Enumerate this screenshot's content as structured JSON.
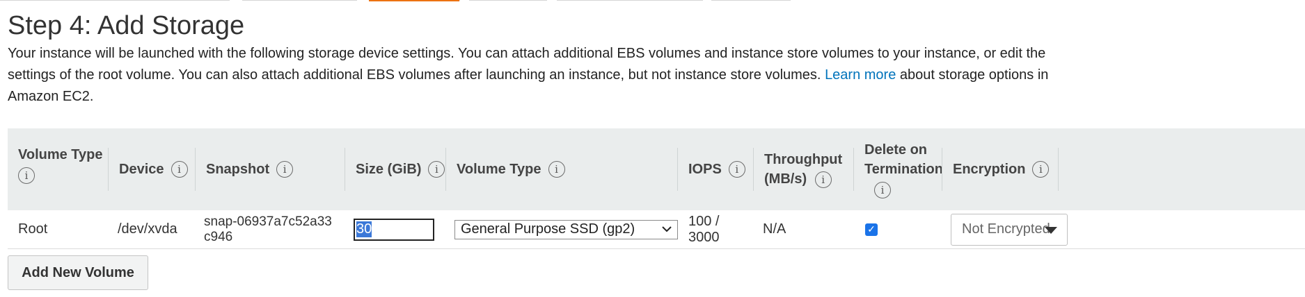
{
  "page": {
    "title": "Step 4: Add Storage",
    "description": "Your instance will be launched with the following storage device settings. You can attach additional EBS volumes and instance store volumes to your instance, or edit the settings of the root volume. You can also attach additional EBS volumes after launching an instance, but not instance store volumes.",
    "learn_more": "Learn more",
    "description_tail": "about storage options in Amazon EC2."
  },
  "table": {
    "headers": {
      "volume_type": "Volume Type",
      "device": "Device",
      "snapshot": "Snapshot",
      "size": "Size (GiB)",
      "volume_type2": "Volume Type",
      "iops": "IOPS",
      "throughput": "Throughput (MB/s)",
      "delete_on_termination": "Delete on Termination",
      "encryption": "Encryption"
    },
    "rows": [
      {
        "volume_type": "Root",
        "device": "/dev/xvda",
        "snapshot": "snap-06937a7c52a33c946",
        "size": "30",
        "volume_type_select": "General Purpose SSD (gp2)",
        "iops": "100 / 3000",
        "throughput": "N/A",
        "delete_on_termination": true,
        "encryption": "Not Encrypted"
      }
    ]
  },
  "actions": {
    "add_volume": "Add New Volume"
  },
  "colors": {
    "accent": "#ec7211",
    "link": "#0073bb",
    "header_bg": "#eaeded"
  }
}
